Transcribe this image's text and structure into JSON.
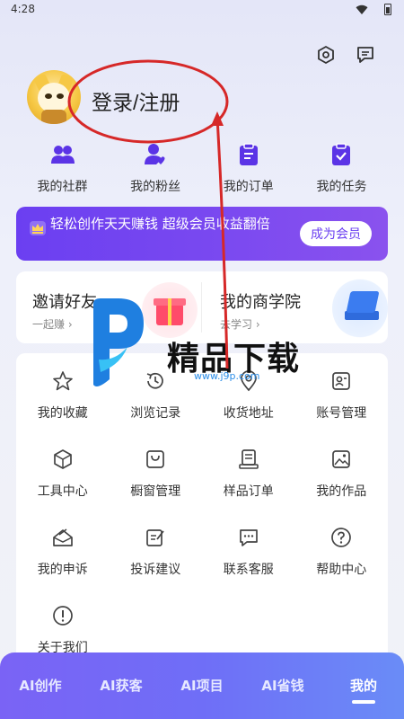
{
  "status": {
    "time": "4:28"
  },
  "profile": {
    "login_label": "登录/注册"
  },
  "quick_links": [
    {
      "label": "我的社群",
      "icon": "group-icon"
    },
    {
      "label": "我的粉丝",
      "icon": "fans-icon"
    },
    {
      "label": "我的订单",
      "icon": "order-clipboard-icon"
    },
    {
      "label": "我的任务",
      "icon": "task-check-icon"
    }
  ],
  "vip_banner": {
    "text": "轻松创作天天赚钱 超级会员收益翻倍",
    "button_label": "成为会员"
  },
  "promo": {
    "invite": {
      "title": "邀请好友",
      "subtitle": "一起赚 ›"
    },
    "school": {
      "title": "我的商学院",
      "subtitle": "去学习 ›"
    }
  },
  "services": [
    {
      "label": "我的收藏",
      "icon": "star-icon"
    },
    {
      "label": "浏览记录",
      "icon": "history-icon"
    },
    {
      "label": "收货地址",
      "icon": "location-pin-icon"
    },
    {
      "label": "账号管理",
      "icon": "id-card-icon"
    },
    {
      "label": "工具中心",
      "icon": "cube-icon"
    },
    {
      "label": "橱窗管理",
      "icon": "shopping-bag-icon"
    },
    {
      "label": "样品订单",
      "icon": "sample-doc-icon"
    },
    {
      "label": "我的作品",
      "icon": "gallery-icon"
    },
    {
      "label": "我的申诉",
      "icon": "appeal-envelope-icon"
    },
    {
      "label": "投诉建议",
      "icon": "feedback-edit-icon"
    },
    {
      "label": "联系客服",
      "icon": "chat-bubble-icon"
    },
    {
      "label": "帮助中心",
      "icon": "help-circle-icon"
    },
    {
      "label": "关于我们",
      "icon": "info-exclamation-icon"
    }
  ],
  "watermark": {
    "title": "精品下载",
    "url": "www.j9p.com"
  },
  "bottom_tabs": [
    {
      "label": "AI创作"
    },
    {
      "label": "AI获客"
    },
    {
      "label": "AI项目"
    },
    {
      "label": "AI省钱"
    },
    {
      "label": "我的",
      "active": true
    }
  ],
  "colors": {
    "accent": "#6b3ff1",
    "icon": "#5b34e6",
    "annotation": "#d62828"
  }
}
